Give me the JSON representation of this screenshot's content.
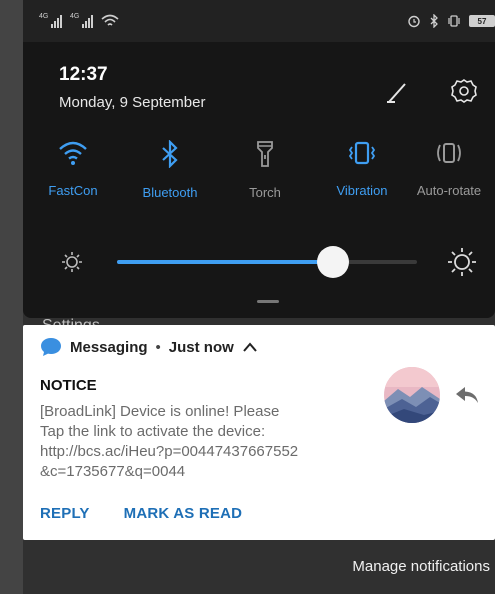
{
  "status_bar": {
    "signal_1_label": "4G",
    "signal_2_label": "4G",
    "battery_level": "57",
    "left_icons": [
      "signal-icon",
      "signal-icon",
      "wifi-icon"
    ],
    "right_icons": [
      "alarm-icon",
      "bluetooth-icon",
      "vibration-icon",
      "battery-icon"
    ]
  },
  "header": {
    "time": "12:37",
    "date": "Monday, 9 September"
  },
  "quick_settings": [
    {
      "label": "FastCon",
      "icon": "wifi-icon",
      "active": true
    },
    {
      "label": "Bluetooth",
      "icon": "bluetooth-icon",
      "active": true
    },
    {
      "label": "Torch",
      "icon": "torch-icon",
      "active": false
    },
    {
      "label": "Vibration",
      "icon": "vibration-icon",
      "active": true
    },
    {
      "label": "Auto-rotate",
      "icon": "auto-rotate-icon",
      "active": false
    }
  ],
  "brightness": {
    "level": 0.72
  },
  "behind_text": "Settings",
  "notification": {
    "app": "Messaging",
    "separator": "•",
    "time": "Just now",
    "title": "NOTICE",
    "body": "[BroadLink] Device is online! Please\nTap the link to activate the device:\nhttp://bcs.ac/iHeu?p=00447437667552\n&c=1735677&q=0044",
    "actions": {
      "reply": "REPLY",
      "mark_read": "MARK AS READ"
    }
  },
  "footer": {
    "manage": "Manage notifications"
  },
  "colors": {
    "accent": "#3f9ef2",
    "inactive": "#9a9a9a",
    "action": "#1e6fb6",
    "panel_bg": "#161616"
  }
}
